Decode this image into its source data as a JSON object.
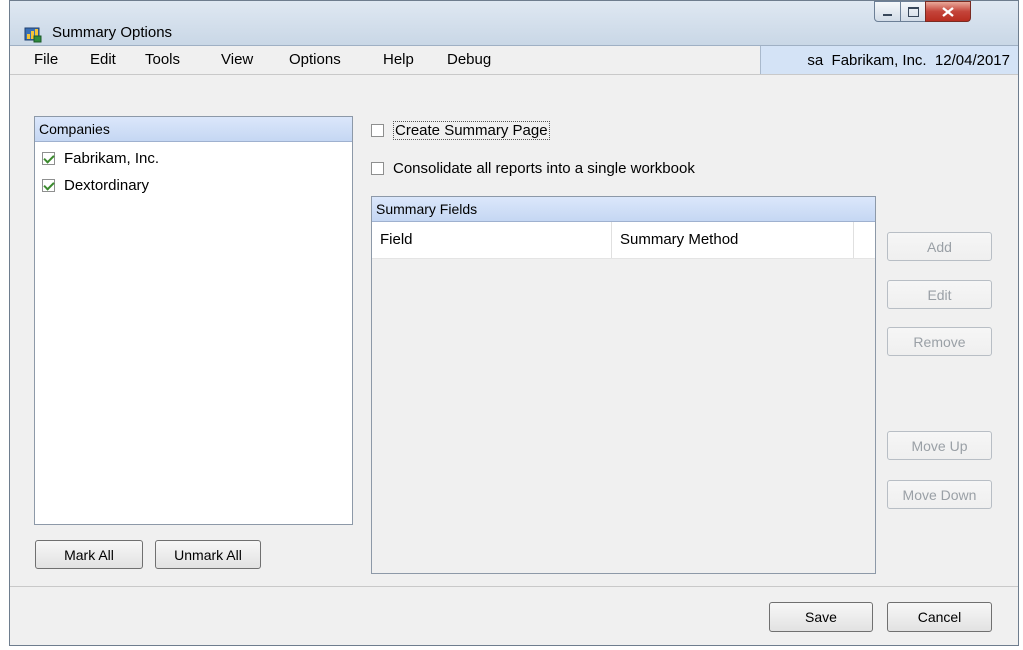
{
  "window": {
    "title": "Summary Options",
    "min_icon": "minimize-icon",
    "max_icon": "maximize-icon",
    "close_icon": "close-icon"
  },
  "menu": {
    "items": [
      "File",
      "Edit",
      "Tools",
      "View",
      "Options",
      "Help",
      "Debug"
    ],
    "user_info": "sa  Fabrikam, Inc.  12/04/2017"
  },
  "companies": {
    "header": "Companies",
    "items": [
      {
        "label": "Fabrikam, Inc.",
        "checked": true
      },
      {
        "label": "Dextordinary",
        "checked": true
      }
    ],
    "mark_all": "Mark All",
    "unmark_all": "Unmark All"
  },
  "options": {
    "create_summary": "Create Summary Page",
    "create_summary_checked": false,
    "consolidate": "Consolidate all reports into a single workbook",
    "consolidate_checked": false
  },
  "summary_fields": {
    "header": "Summary Fields",
    "columns": [
      "Field",
      "Summary Method"
    ]
  },
  "side_buttons": {
    "add": "Add",
    "edit": "Edit",
    "remove": "Remove",
    "move_up": "Move Up",
    "move_down": "Move Down"
  },
  "footer": {
    "save": "Save",
    "cancel": "Cancel"
  },
  "colors": {
    "header_blue": "#c5d7f3",
    "user_info_bg": "#d4e3f6",
    "close_red": "#c4443a",
    "check_green": "#3b8a2e"
  }
}
